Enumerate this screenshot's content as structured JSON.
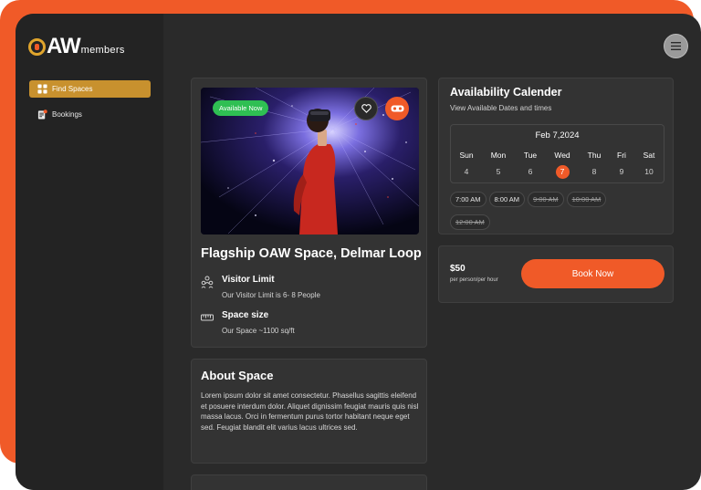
{
  "brand": {
    "logo_letters": "OAW",
    "logo_suffix": "members"
  },
  "sidebar": {
    "items": [
      {
        "label": "Find Spaces",
        "icon": "grid-icon",
        "active": true
      },
      {
        "label": "Bookings",
        "icon": "bookings-icon",
        "active": false
      }
    ]
  },
  "header": {
    "menu_icon": "hamburger-menu-icon"
  },
  "space": {
    "badge": "Available Now",
    "image": "person-in-vr-headset-particle-lights",
    "title": "Flagship OAW Space, Delmar Loop",
    "features": [
      {
        "name": "Visitor Limit",
        "desc": "Our Visitor Limit is 6- 8 People",
        "icon": "people-icon"
      },
      {
        "name": "Space size",
        "desc": "Our Space ~1100 sq/ft",
        "icon": "ruler-icon"
      }
    ]
  },
  "about": {
    "title": "About Space",
    "body": "Lorem ipsum dolor sit amet consectetur. Phasellus sagittis eleifend et posuere interdum dolor. Aliquet dignissim feugiat mauris quis nisl massa lacus. Orci in fermentum purus tortor habitant neque eget sed. Feugiat blandit elit varius lacus ultrices sed."
  },
  "availability": {
    "title": "Availability Calender",
    "subtitle": "View Available Dates and times",
    "date": "Feb 7,2024",
    "days": [
      {
        "name": "Sun",
        "num": "4"
      },
      {
        "name": "Mon",
        "num": "5"
      },
      {
        "name": "Tue",
        "num": "6"
      },
      {
        "name": "Wed",
        "num": "7",
        "selected": true
      },
      {
        "name": "Thu",
        "num": "8"
      },
      {
        "name": "Fri",
        "num": "9"
      },
      {
        "name": "Sat",
        "num": "10"
      }
    ],
    "slots": [
      {
        "time": "7:00 AM",
        "available": true
      },
      {
        "time": "8:00 AM",
        "available": true
      },
      {
        "time": "9:00 AM",
        "available": false
      },
      {
        "time": "10:00 AM",
        "available": false
      },
      {
        "time": "12:00 AM",
        "available": false
      }
    ]
  },
  "booking": {
    "price": "$50",
    "unit": "per person/per hour",
    "button": "Book Now"
  },
  "colors": {
    "accent": "#f05a28",
    "gold": "#c8912e",
    "badge_green": "#2fbf53",
    "panel": "#333333",
    "background": "#2a2a2a"
  }
}
